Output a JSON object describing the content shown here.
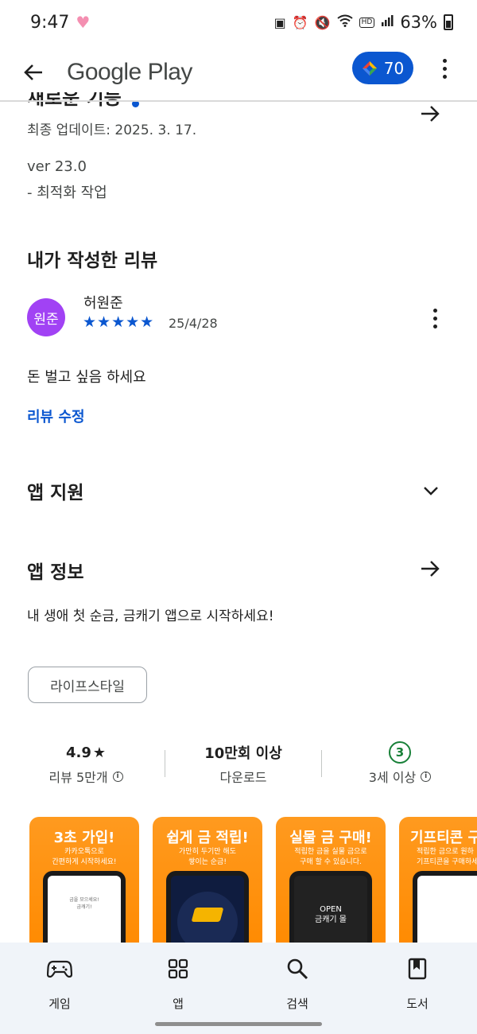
{
  "status_bar": {
    "time": "9:47",
    "battery": "63%",
    "hd_label": "HD\nVoice"
  },
  "app_bar": {
    "title": "Google Play",
    "points": "70"
  },
  "whats_new": {
    "title": "새로운 기능",
    "updated": "최종 업데이트: 2025. 3. 17.",
    "version": "ver 23.0",
    "note": "- 최적화 작업"
  },
  "my_review": {
    "heading": "내가 작성한 리뷰",
    "avatar_text": "원준",
    "reviewer": "허원준",
    "stars": "★★★★★",
    "rating": 5,
    "date": "25/4/28",
    "body": "돈 벌고 싶음 하세요",
    "edit_label": "리뷰 수정"
  },
  "app_support": {
    "heading": "앱 지원"
  },
  "app_info": {
    "heading": "앱 정보",
    "description": "내 생애 첫 순금, 금캐기 앱으로 시작하세요!",
    "tag": "라이프스타일"
  },
  "stats": {
    "rating": "4.9",
    "star": "★",
    "reviews": "리뷰 5만개",
    "downloads": "10만회 이상",
    "downloads_label": "다운로드",
    "age_badge": "3",
    "age_label": "3세 이상"
  },
  "screenshots": [
    {
      "title": "3초 가입!",
      "subtitle": "카카오톡으로\n간편하게 시작하세요!",
      "screen": "금을 모으세요!\n금캐기!"
    },
    {
      "title": "쉽게 금 적립!",
      "subtitle": "가만히 두기만 해도\n쌓이는 순금!",
      "screen": ""
    },
    {
      "title": "실물 금 구매!",
      "subtitle": "적립한 금을 실물 금으로\n구매 할 수 있습니다.",
      "screen": "OPEN\n금캐기 몰"
    },
    {
      "title": "기프티콘 구",
      "subtitle": "적립한 금으로 원하\n기프티콘을 구매하세",
      "screen": ""
    }
  ],
  "bottom_nav": {
    "items": [
      {
        "label": "게임",
        "icon": "gamepad-icon"
      },
      {
        "label": "앱",
        "icon": "apps-grid-icon"
      },
      {
        "label": "검색",
        "icon": "search-icon"
      },
      {
        "label": "도서",
        "icon": "book-icon"
      }
    ]
  },
  "colors": {
    "accent": "#0b57d0",
    "avatar": "#a142f4",
    "age_badge": "#188038",
    "screenshot_bg": "#ff8a00"
  }
}
